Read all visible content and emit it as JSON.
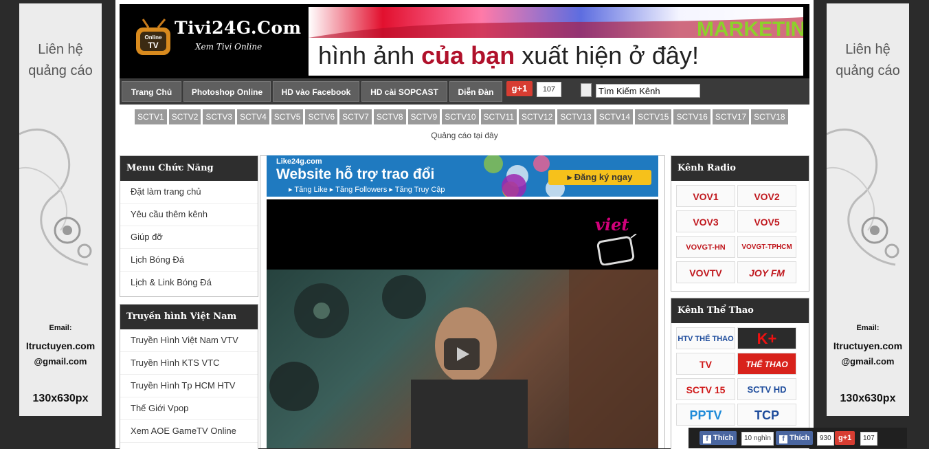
{
  "side_ads": {
    "contact": "Liên hệ",
    "ads": "quảng cáo",
    "email_label": "Email:",
    "email_line1": "Itructuyen.com",
    "email_line2": "@gmail.com",
    "size": "130x630px"
  },
  "header": {
    "logo_badge": "Online",
    "logo_title": "Tivi24G.Com",
    "logo_subtitle": "Xem Tivi Online",
    "banner_text_1": "hình ảnh ",
    "banner_text_2": "của bạn",
    "banner_text_3": " xuất hiện ở đây!",
    "banner_keyword": "MARKETING"
  },
  "nav": {
    "items": [
      "Trang Chủ",
      "Photoshop Online",
      "HD vào Facebook",
      "HD cài SOPCAST",
      "Diễn Đàn"
    ],
    "gplus_label": "g+1",
    "gplus_count": "107",
    "search_value": "Tìm Kiếm Kênh"
  },
  "channels": [
    "SCTV1",
    "SCTV2",
    "SCTV3",
    "SCTV4",
    "SCTV5",
    "SCTV6",
    "SCTV7",
    "SCTV8",
    "SCTV9",
    "SCTV10",
    "SCTV11",
    "SCTV12",
    "SCTV13",
    "SCTV14",
    "SCTV15",
    "SCTV16",
    "SCTV17",
    "SCTV18"
  ],
  "ad_text": "Quảng cáo tại đây",
  "menu": {
    "title": "Menu Chức Năng",
    "items": [
      "Đặt làm trang chủ",
      "Yêu cầu thêm kênh",
      "Giúp đỡ",
      "Lịch Bóng Đá",
      "Lịch & Link Bóng Đá"
    ]
  },
  "vietnam_tv": {
    "title": "Truyền hình Việt Nam",
    "items": [
      "Truyền Hình Việt Nam VTV",
      "Truyền Hình KTS VTC",
      "Truyền Hình Tp HCM HTV",
      "Thế Giới Vpop",
      "Xem AOE GameTV Online"
    ]
  },
  "promo": {
    "site": "Like24g.com",
    "headline": "Website hỗ trợ trao đổi",
    "features": "▸ Tăng Like  ▸ Tăng Followers  ▸ Tăng Truy Cập",
    "button": "▸ Đăng ký ngay"
  },
  "video": {
    "channel_logo": "viet"
  },
  "radio": {
    "title": "Kênh Radio",
    "logos": [
      "VOV1",
      "VOV2",
      "VOV3",
      "VOV5",
      "VOVGT-HN",
      "VOVGT-TPHCM",
      "VOVTV",
      "JOY FM"
    ]
  },
  "sports": {
    "title": "Kênh Thể Thao",
    "logos": [
      "HTV THỂ THAO",
      "K+",
      "TV",
      "THỂ THAO",
      "SCTV 15",
      "SCTV HD",
      "PPTV",
      "TCP"
    ]
  },
  "social": {
    "like1": "Thích",
    "like1_count": "10 nghìn",
    "like2": "Thích",
    "like2_count": "930",
    "gplus": "g+1",
    "gplus_count": "107"
  }
}
